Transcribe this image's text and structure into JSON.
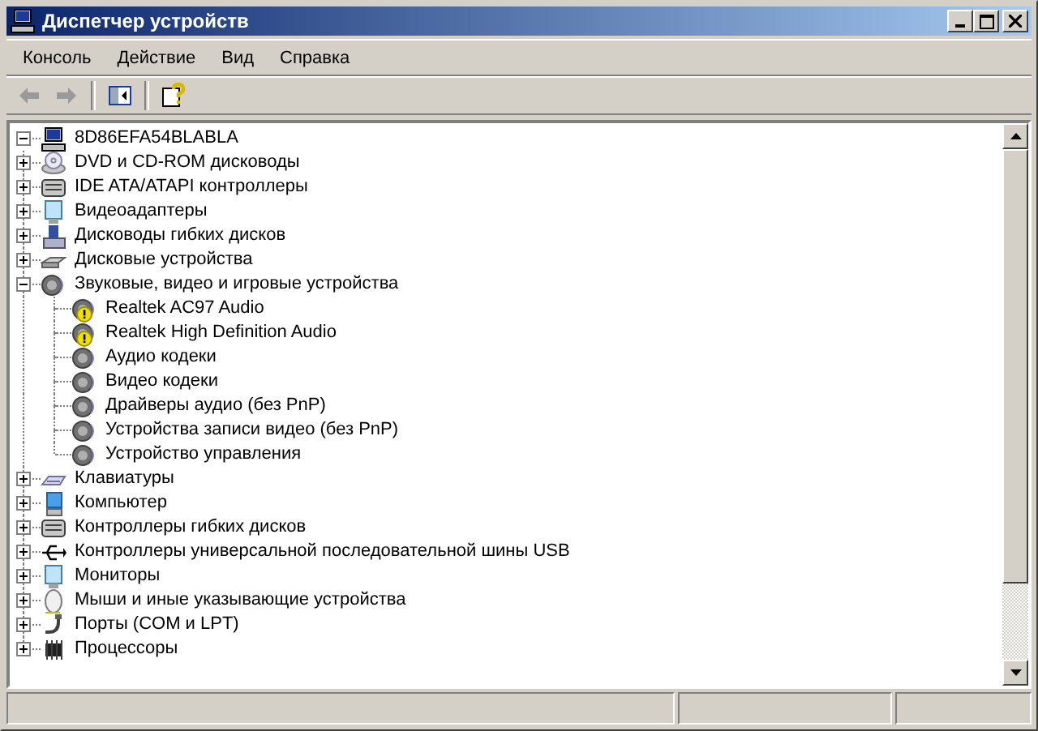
{
  "window": {
    "title": "Диспетчер устройств"
  },
  "menu": [
    "Консоль",
    "Действие",
    "Вид",
    "Справка"
  ],
  "tree": {
    "label": "8D86EFA54BLABLA",
    "kind": "computer",
    "expanded": true,
    "children": [
      {
        "label": "DVD и CD-ROM дисководы",
        "kind": "dvd",
        "expanded": false
      },
      {
        "label": "IDE ATA/ATAPI контроллеры",
        "kind": "ide",
        "expanded": false
      },
      {
        "label": "Видеоадаптеры",
        "kind": "display",
        "expanded": false
      },
      {
        "label": "Дисководы гибких дисков",
        "kind": "floppy",
        "expanded": false
      },
      {
        "label": "Дисковые устройства",
        "kind": "disk",
        "expanded": false
      },
      {
        "label": "Звуковые, видео и игровые устройства",
        "kind": "sound",
        "expanded": true,
        "children": [
          {
            "label": "Realtek AC97 Audio",
            "kind": "sound",
            "warning": true
          },
          {
            "label": "Realtek High Definition Audio",
            "kind": "sound",
            "warning": true
          },
          {
            "label": "Аудио кодеки",
            "kind": "sound",
            "warning": false
          },
          {
            "label": "Видео кодеки",
            "kind": "sound",
            "warning": false
          },
          {
            "label": "Драйверы аудио (без PnP)",
            "kind": "sound",
            "warning": false
          },
          {
            "label": "Устройства записи видео (без PnP)",
            "kind": "sound",
            "warning": false
          },
          {
            "label": "Устройство управления",
            "kind": "sound",
            "warning": false
          }
        ]
      },
      {
        "label": "Клавиатуры",
        "kind": "keyboard",
        "expanded": false
      },
      {
        "label": "Компьютер",
        "kind": "pc",
        "expanded": false
      },
      {
        "label": "Контроллеры гибких дисков",
        "kind": "ide",
        "expanded": false
      },
      {
        "label": "Контроллеры универсальной последовательной шины USB",
        "kind": "usb",
        "expanded": false
      },
      {
        "label": "Мониторы",
        "kind": "display",
        "expanded": false
      },
      {
        "label": "Мыши и иные указывающие устройства",
        "kind": "mouse",
        "expanded": false
      },
      {
        "label": "Порты (COM и LPT)",
        "kind": "port",
        "expanded": false
      },
      {
        "label": "Процессоры",
        "kind": "cpu",
        "expanded": false
      }
    ]
  }
}
